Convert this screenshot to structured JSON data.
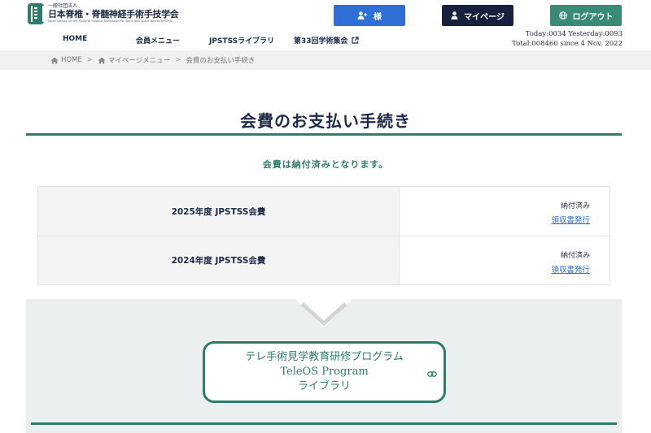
{
  "org": {
    "line1": "一般社団法人",
    "name": "日本脊椎・脊髄神経手術手技学会",
    "english": "Japan Society for the Study of Surgical Techniques for Spine and Spinal Nerves (JPSTSS)"
  },
  "header": {
    "user_label": "様",
    "mypage_label": "マイページ",
    "logout_label": "ログアウト"
  },
  "nav": {
    "home": "HOME",
    "member_menu": "会員メニュー",
    "library": "JPSTSSライブラリ",
    "meeting": "第33回学術集会"
  },
  "counter": {
    "line1": "Today:0034 Yesterday:0093",
    "line2": "Total:008460 since 4 Nov. 2022"
  },
  "breadcrumb": {
    "home": "HOME",
    "mypage": "マイページメニュー",
    "current": "会費のお支払い手続き"
  },
  "page": {
    "title": "会費のお支払い手続き",
    "status_message": "会費は納付済みとなります。"
  },
  "fees": [
    {
      "name": "2025年度 JPSTSS会費",
      "status": "納付済み",
      "receipt_link": "領収書発行"
    },
    {
      "name": "2024年度 JPSTSS会費",
      "status": "納付済み",
      "receipt_link": "領収書発行"
    }
  ],
  "program": {
    "line1": "テレ手術見学教育研修プログラム",
    "line2": "TeleOS Program",
    "line3": "ライブラリ"
  },
  "colors": {
    "accent": "#2e7d6b",
    "navy": "#16213e",
    "blue": "#2f6fd6"
  },
  "icons": [
    "user-plus-icon",
    "user-icon",
    "globe-icon",
    "external-link-icon",
    "home-icon",
    "chain-link-icon"
  ]
}
